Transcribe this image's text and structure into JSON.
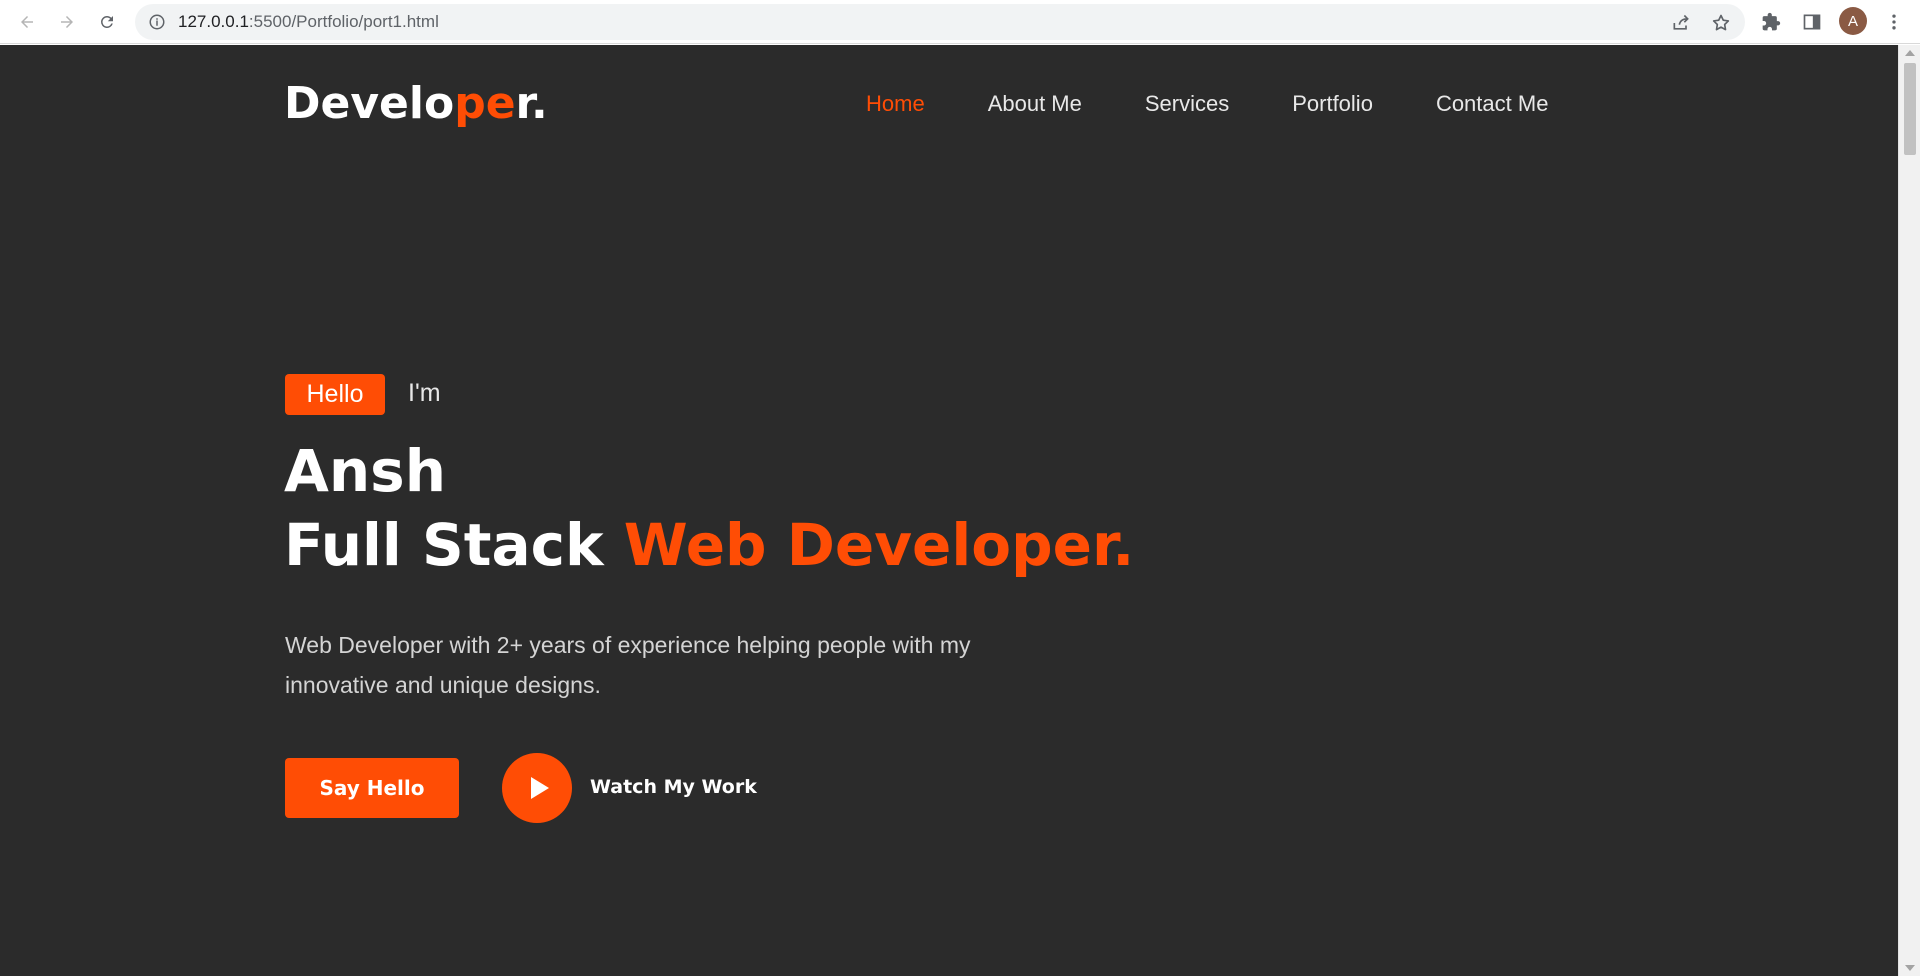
{
  "browser": {
    "url_host": "127.0.0.1",
    "url_rest": ":5500/Portfolio/port1.html",
    "profile_initial": "A",
    "icons": {
      "back": "back-arrow-icon",
      "forward": "forward-arrow-icon",
      "reload": "reload-icon",
      "site_info": "info-icon",
      "share": "share-icon",
      "bookmark": "star-icon",
      "extensions": "puzzle-icon",
      "side_panel": "side-panel-icon",
      "menu": "kebab-menu-icon"
    }
  },
  "header": {
    "logo_part1": "Develo",
    "logo_accent": "pe",
    "logo_part2": "r.",
    "nav": [
      {
        "label": "Home",
        "active": true
      },
      {
        "label": "About Me",
        "active": false
      },
      {
        "label": "Services",
        "active": false
      },
      {
        "label": "Portfolio",
        "active": false
      },
      {
        "label": "Contact Me",
        "active": false
      }
    ]
  },
  "hero": {
    "badge": "Hello",
    "im": "I'm",
    "name": "Ansh",
    "title_plain": "Full Stack",
    "title_accent": "Web Developer.",
    "description_line1": "Web Developer with 2+ years of experience helping people with my",
    "description_line2": "innovative and unique designs.",
    "cta_label": "Say Hello",
    "watch_label": "Watch My Work"
  },
  "colors": {
    "accent": "#ff4d05",
    "background": "#2b2b2b",
    "text": "#ffffff"
  }
}
